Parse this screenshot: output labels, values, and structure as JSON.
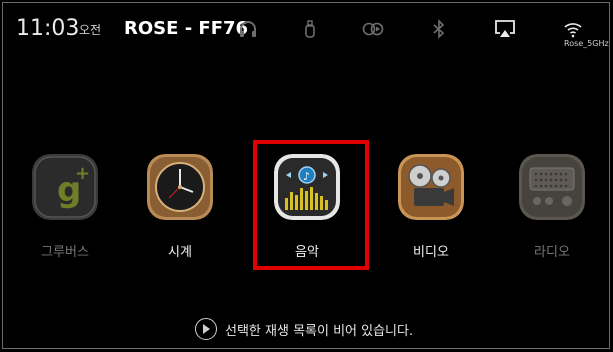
{
  "status_bar": {
    "time": "11:03",
    "ampm": "오전",
    "device_name": "ROSE - FF76",
    "wifi_label": "Rose_5GHz"
  },
  "apps": [
    {
      "label": "그루버스",
      "icon": "groovers-icon",
      "state": "dim"
    },
    {
      "label": "시계",
      "icon": "clock-icon",
      "state": "bright"
    },
    {
      "label": "음악",
      "icon": "music-icon",
      "state": "selected"
    },
    {
      "label": "비디오",
      "icon": "video-icon",
      "state": "bright"
    },
    {
      "label": "라디오",
      "icon": "radio-icon",
      "state": "dim"
    }
  ],
  "now_playing": {
    "message": "선택한 재생 목록이 비어 있습니다."
  },
  "colors": {
    "background": "#000000",
    "highlight": "#e00000"
  }
}
